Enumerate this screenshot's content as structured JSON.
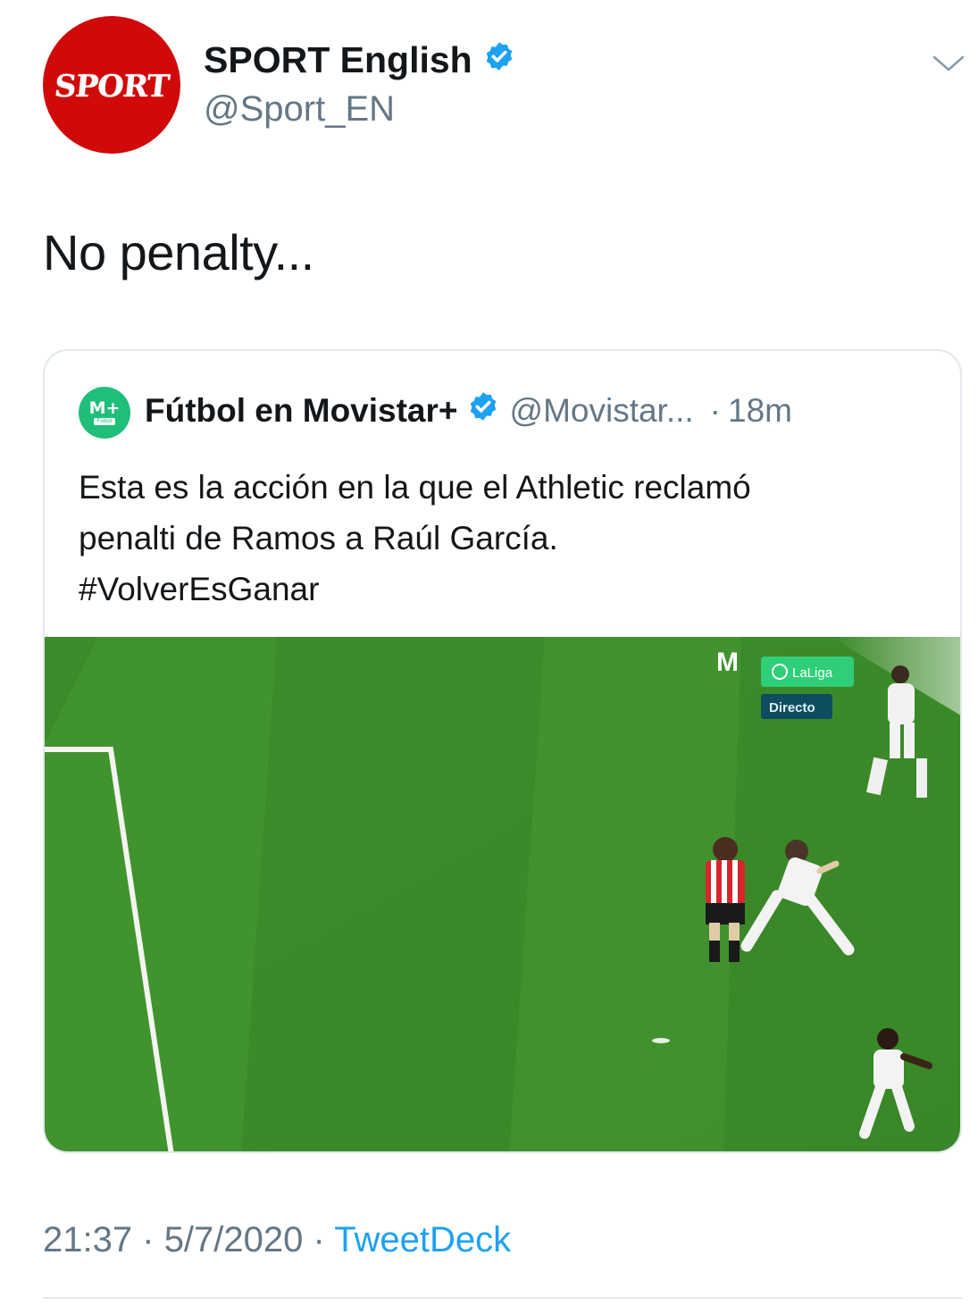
{
  "tweet": {
    "author": {
      "display_name": "SPORT English",
      "handle": "@Sport_EN",
      "verified": true,
      "avatar_logo_text": "SPORT",
      "avatar_color": "#d00a0a"
    },
    "text": "No penalty...",
    "quoted": {
      "author": {
        "display_name": "Fútbol en Movistar+",
        "handle": "@Movistar...",
        "verified": true,
        "avatar_text": "M+",
        "avatar_subtext": "Fútbol",
        "avatar_color": "#1fbf7a"
      },
      "separator": "·",
      "time_ago": "18m",
      "text_lines": [
        "Esta es la acción en la que el Athletic reclamó",
        "penalti de Ramos a Raúl García.",
        "#VolverEsGanar"
      ],
      "media": {
        "broadcaster_logo": "M",
        "league_badge": "LaLiga",
        "live_badge": "Directo"
      }
    },
    "footer": {
      "time": "21:37",
      "dot": "·",
      "date": "5/7/2020",
      "source": "TweetDeck"
    }
  },
  "colors": {
    "text_primary": "#14171a",
    "text_secondary": "#657786",
    "link": "#1da1f2",
    "verified": "#1da1f2",
    "border": "#e1e8ed",
    "pitch": "#3f8e2a"
  }
}
